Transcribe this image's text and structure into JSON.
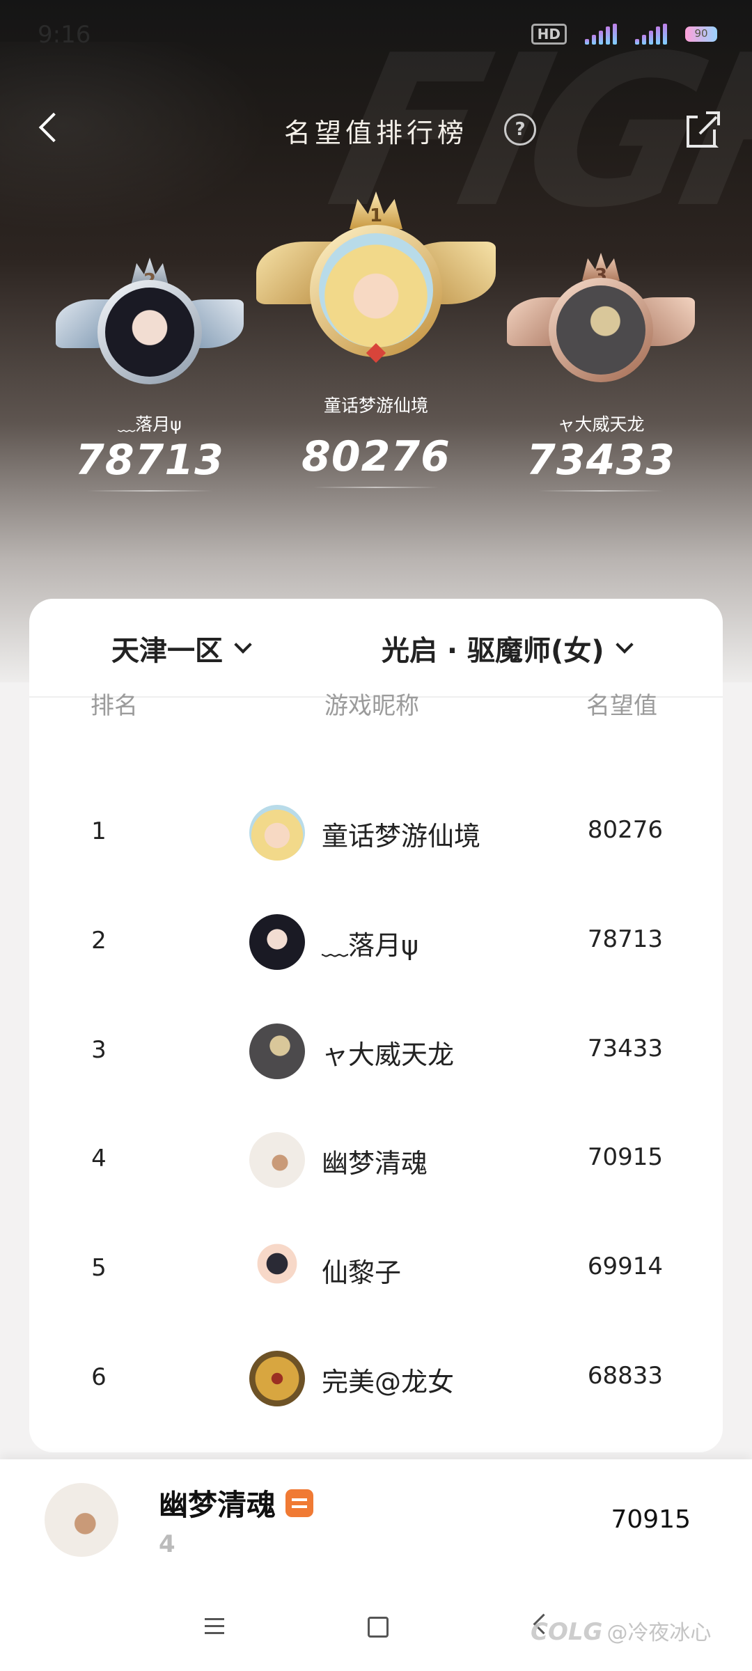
{
  "status_bar": {
    "time": "9:16",
    "hd": "HD",
    "battery": "90"
  },
  "header": {
    "title": "名望值排行榜",
    "help_label": "?"
  },
  "podium": {
    "first": {
      "rank": "1",
      "name": "童话梦游仙境",
      "score": "80276"
    },
    "second": {
      "rank": "2",
      "name": "﹏落月ψ",
      "score": "78713"
    },
    "third": {
      "rank": "3",
      "name": "ャ大威天龙",
      "score": "73433"
    }
  },
  "filters": {
    "server": "天津一区",
    "class": "光启 · 驱魔师(女)"
  },
  "table": {
    "headers": {
      "rank": "排名",
      "nickname": "游戏昵称",
      "score": "名望值"
    },
    "rows": [
      {
        "rank": "1",
        "nickname": "童话梦游仙境",
        "score": "80276"
      },
      {
        "rank": "2",
        "nickname": "﹏落月ψ",
        "score": "78713"
      },
      {
        "rank": "3",
        "nickname": "ャ大威天龙",
        "score": "73433"
      },
      {
        "rank": "4",
        "nickname": "幽梦清魂",
        "score": "70915"
      },
      {
        "rank": "5",
        "nickname": "仙黎子",
        "score": "69914"
      },
      {
        "rank": "6",
        "nickname": "完美@龙女",
        "score": "68833"
      }
    ]
  },
  "my_rank": {
    "nickname": "幽梦清魂",
    "rank": "4",
    "score": "70915"
  },
  "watermark": {
    "brand": "COLG",
    "author": "@冷夜冰心"
  }
}
